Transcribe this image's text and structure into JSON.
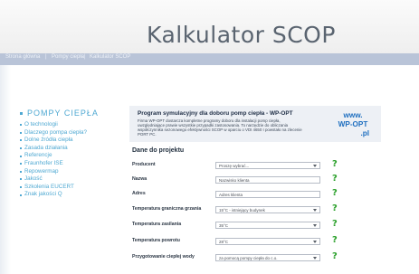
{
  "header": {
    "title": "Kalkulator SCOP"
  },
  "breadcrumb": [
    "Strona główna",
    "Pompy ciepła",
    "Kalkulator SCOP"
  ],
  "sidebar": {
    "heading": "POMPY CIEPŁA",
    "items": [
      "O technologii",
      "Dlaczego pompa ciepła?",
      "Dolne źródła ciepła",
      "Zasada działania",
      "Referencje",
      "Fraunhofer ISE",
      "Repowermap",
      "Jakość",
      "Szkolenia EUCERT",
      "Znak jakości Q"
    ]
  },
  "promo": {
    "title": "Program symulacyjny dla doboru pomp ciepła - WP-OPT",
    "text": "Firma WP-OPT dostarcza kompletne programy doboru dla instalacji pomp ciepła, uwzględniające prawie wszystkie przypadki zastosowania. To narzędzie do obliczania współczynnika sezonowego efektywności SCOP w oparciu o VDI 4650 I powstało na zlecenie PORT PC.",
    "logo_line1": "www.",
    "logo_line2": "WP-OPT",
    "logo_line3": ".pl"
  },
  "form": {
    "title": "Dane do projektu",
    "help_symbol": "?",
    "rows": [
      {
        "label": "Producent",
        "value": "Proszę wybrać..."
      },
      {
        "label": "Nazwa",
        "value": "Nazwisko klienta"
      },
      {
        "label": "Adres",
        "value": "Adres klienta"
      },
      {
        "label": "Temperatura graniczna grzania",
        "value": "15°C - istniejący budynek"
      },
      {
        "label": "Temperatura zasilania",
        "value": "35°C"
      },
      {
        "label": "Temperatura powrotu",
        "value": "28°C"
      },
      {
        "label": "Przygotowanie ciepłej wody",
        "value": "za pomocą pompy ciepła do c.o."
      }
    ]
  }
}
